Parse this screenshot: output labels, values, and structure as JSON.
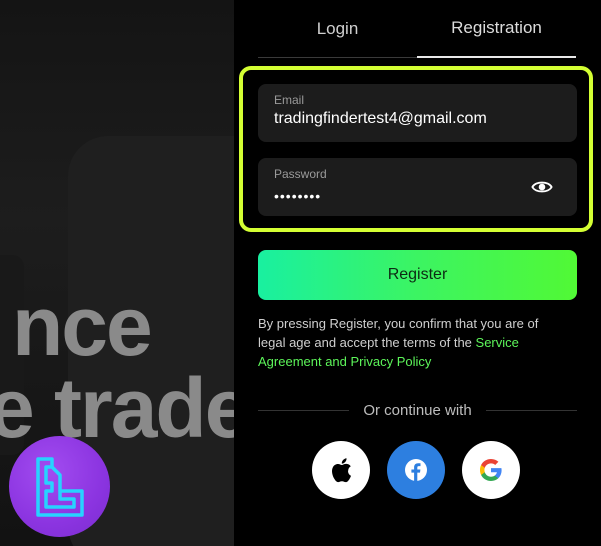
{
  "hero": {
    "line1": "nce",
    "line2": "e trade"
  },
  "tabs": [
    {
      "label": "Login",
      "active": false
    },
    {
      "label": "Registration",
      "active": true
    }
  ],
  "form": {
    "email_label": "Email",
    "email_value": "tradingfindertest4@gmail.com",
    "password_label": "Password",
    "password_value": "••••••••",
    "register_label": "Register"
  },
  "terms": {
    "text": "By pressing Register, you confirm that you are of legal age and accept the terms of the ",
    "link": "Service Agreement and Privacy Policy"
  },
  "divider_text": "Or continue with",
  "social": [
    {
      "name": "apple",
      "icon": "apple-icon"
    },
    {
      "name": "facebook",
      "icon": "facebook-icon"
    },
    {
      "name": "google",
      "icon": "google-icon"
    }
  ],
  "colors": {
    "highlight": "#d4ff33",
    "accent_green": "#5df55a",
    "register_gradient_start": "#19f0a0",
    "register_gradient_end": "#51f935",
    "facebook_blue": "#2d7fe0",
    "logo_purple": "#8b34e0"
  }
}
